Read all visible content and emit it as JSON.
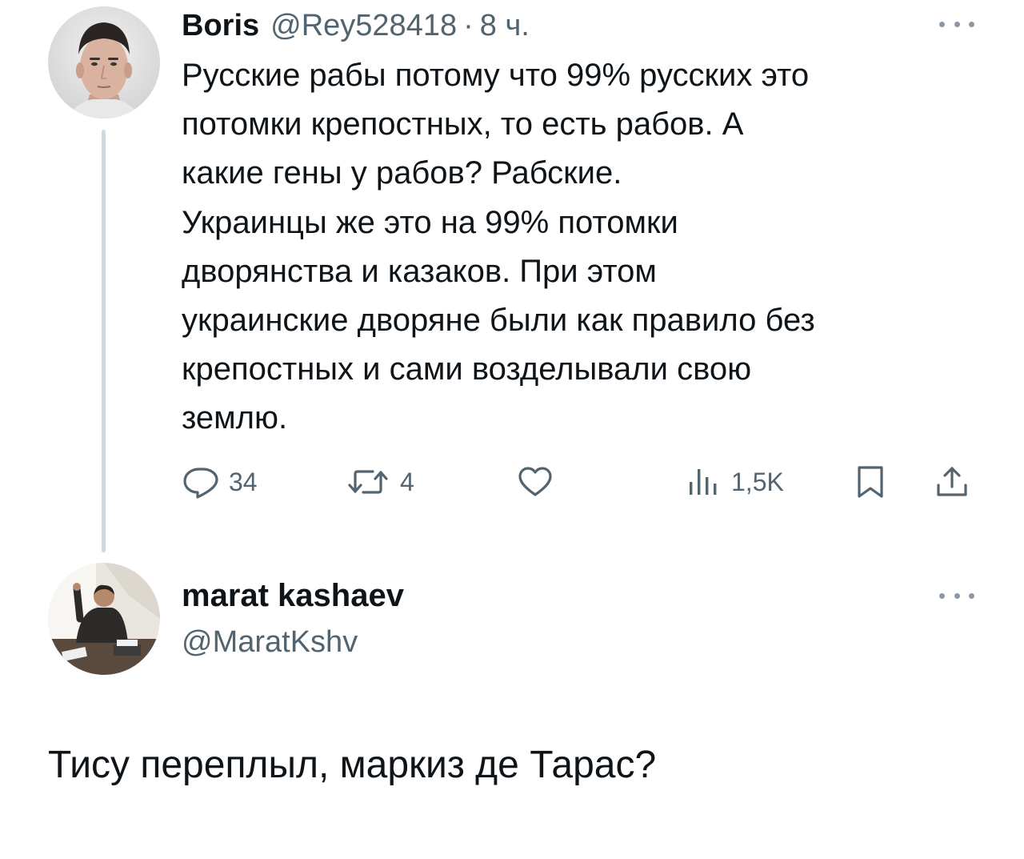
{
  "tweet_main": {
    "display_name": "Boris",
    "handle": "@Rey528418",
    "separator": "·",
    "time": "8 ч.",
    "text_lines": [
      "Русские рабы потому что 99% русских это",
      "потомки крепостных, то есть рабов. А",
      "какие гены у рабов? Рабские.",
      "Украинцы же это на 99% потомки",
      "дворянства и казаков. При этом",
      "украинские дворяне были как правило без",
      "крепостных и сами возделывали свою",
      "землю."
    ],
    "actions": {
      "replies": "34",
      "retweets": "4",
      "likes": "",
      "views": "1,5K"
    },
    "icons": [
      "reply-icon",
      "retweet-icon",
      "like-icon",
      "views-icon",
      "bookmark-icon",
      "share-icon",
      "more-icon"
    ]
  },
  "tweet_reply": {
    "display_name": "marat kashaev",
    "handle": "@MaratKshv",
    "text": "Тису переплыл, маркиз де Тарас?"
  },
  "colors": {
    "text": "#0f1419",
    "secondary": "#536471",
    "thread_line": "#cfd9de",
    "background": "#ffffff"
  }
}
